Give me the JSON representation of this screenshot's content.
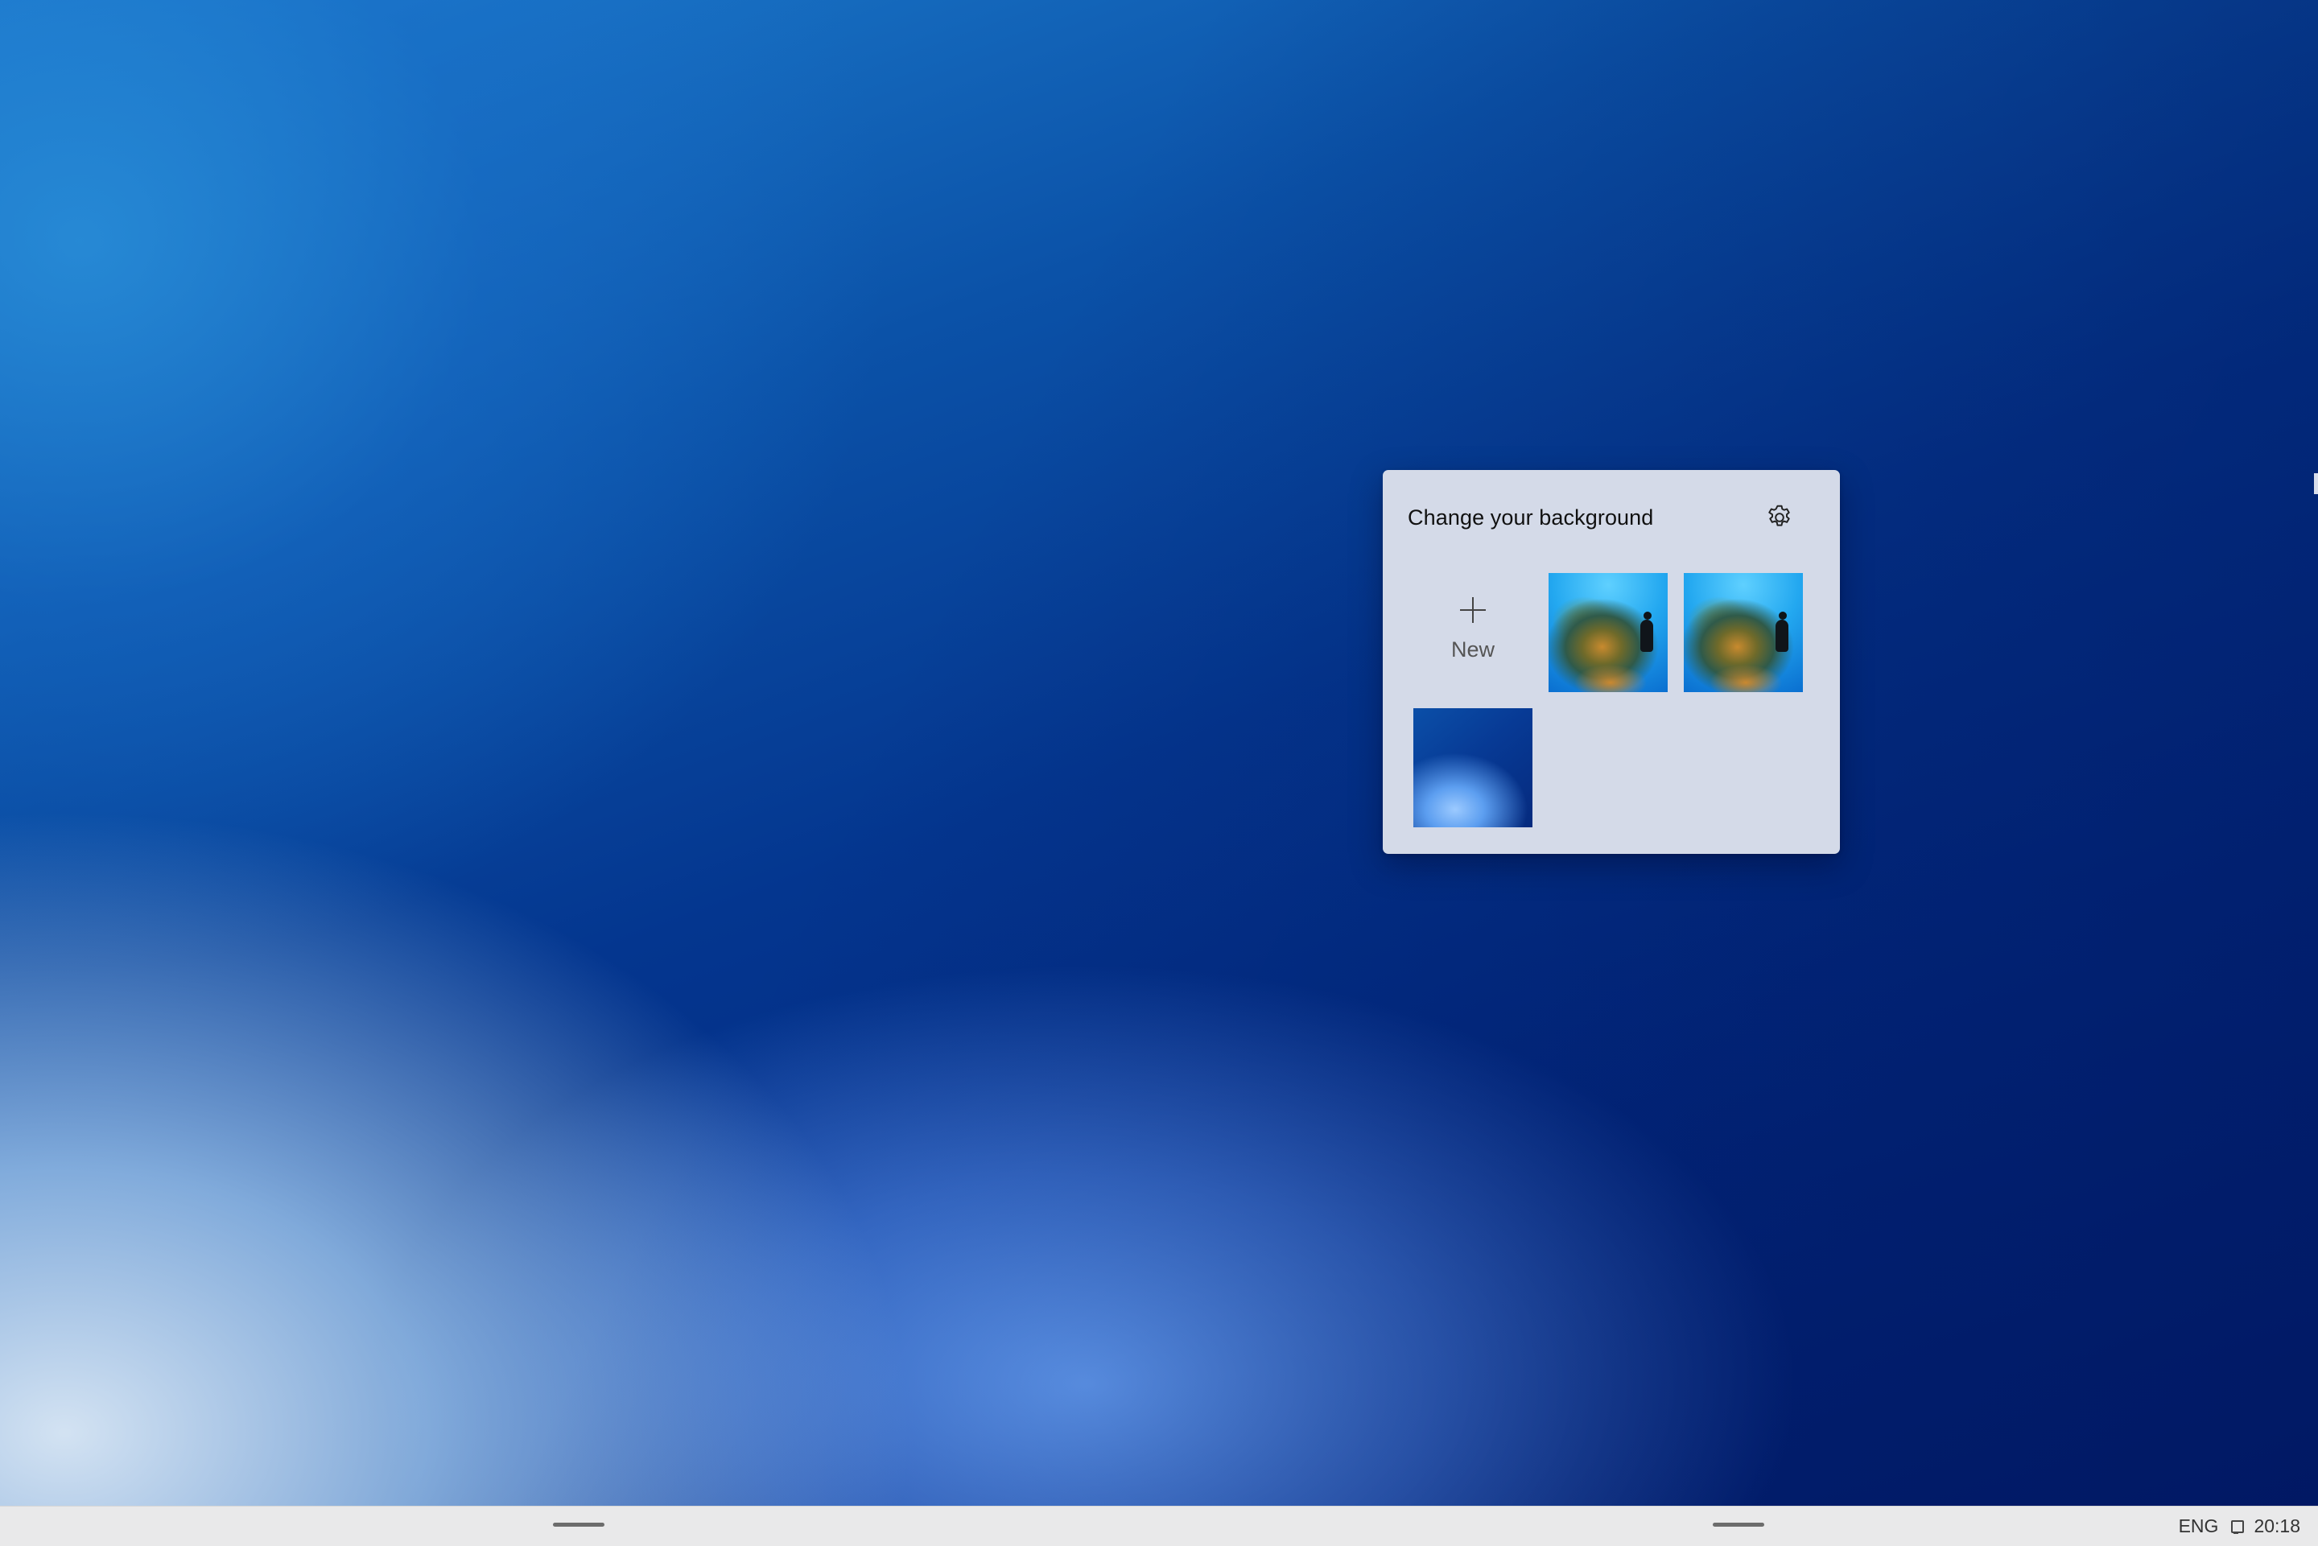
{
  "panel": {
    "title": "Change your background",
    "settings_icon": "gear-icon",
    "tiles": [
      {
        "kind": "new",
        "icon": "plus-icon",
        "label": "New"
      },
      {
        "kind": "image",
        "description": "underwater-reef-diver"
      },
      {
        "kind": "image",
        "description": "underwater-reef-diver"
      },
      {
        "kind": "image",
        "description": "blue-gradient"
      }
    ]
  },
  "taskbar": {
    "language": "ENG",
    "network_icon": "network-icon",
    "time": "20:18"
  },
  "colors": {
    "panel_bg": "#d4dae8",
    "taskbar_bg": "#e9e9ea",
    "desktop_dark": "#011d6e",
    "desktop_light": "#deecf8"
  }
}
